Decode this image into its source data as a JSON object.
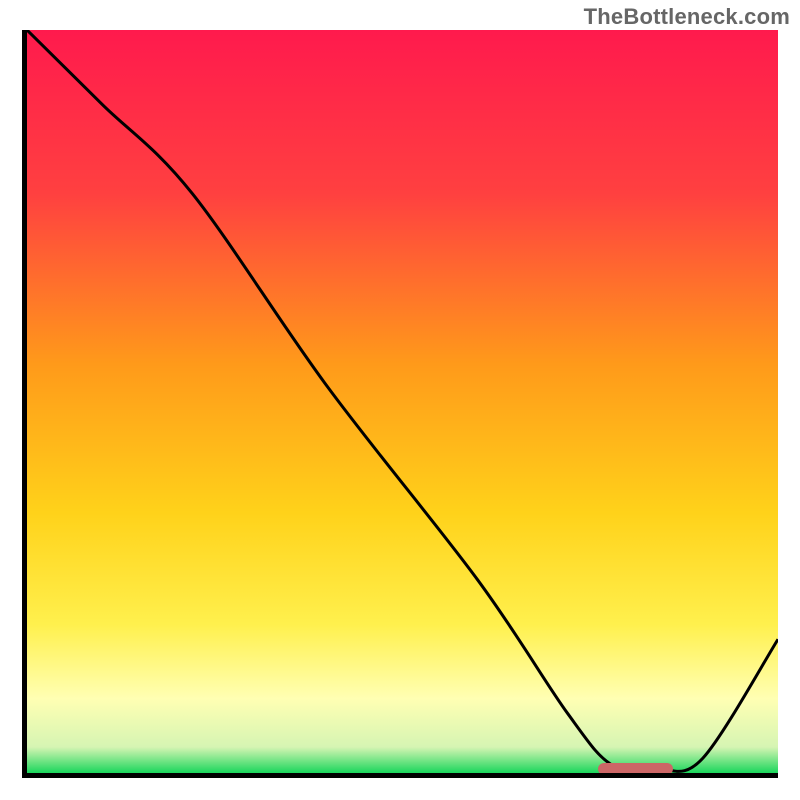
{
  "watermark": "TheBottleneck.com",
  "chart_data": {
    "type": "line",
    "title": "",
    "xlabel": "",
    "ylabel": "",
    "xlim": [
      0,
      100
    ],
    "ylim": [
      0,
      100
    ],
    "grid": false,
    "background_gradient": {
      "stops": [
        {
          "offset": 0.0,
          "color": "#ff1a4d"
        },
        {
          "offset": 0.22,
          "color": "#ff4040"
        },
        {
          "offset": 0.45,
          "color": "#ff9a1a"
        },
        {
          "offset": 0.65,
          "color": "#ffd21a"
        },
        {
          "offset": 0.8,
          "color": "#fff04d"
        },
        {
          "offset": 0.9,
          "color": "#ffffb3"
        },
        {
          "offset": 0.965,
          "color": "#d6f5b3"
        },
        {
          "offset": 1.0,
          "color": "#1ad65c"
        }
      ]
    },
    "series": [
      {
        "name": "curve",
        "color": "#000000",
        "width": 3,
        "x": [
          0,
          10,
          22,
          40,
          60,
          72,
          78,
          84,
          90,
          100
        ],
        "y": [
          100,
          90,
          78,
          52,
          26,
          8,
          1,
          0.5,
          2,
          18
        ]
      }
    ],
    "marker": {
      "name": "highlight-segment",
      "x_start": 76,
      "x_end": 86,
      "y": 0.5,
      "color": "#cc6666"
    }
  }
}
